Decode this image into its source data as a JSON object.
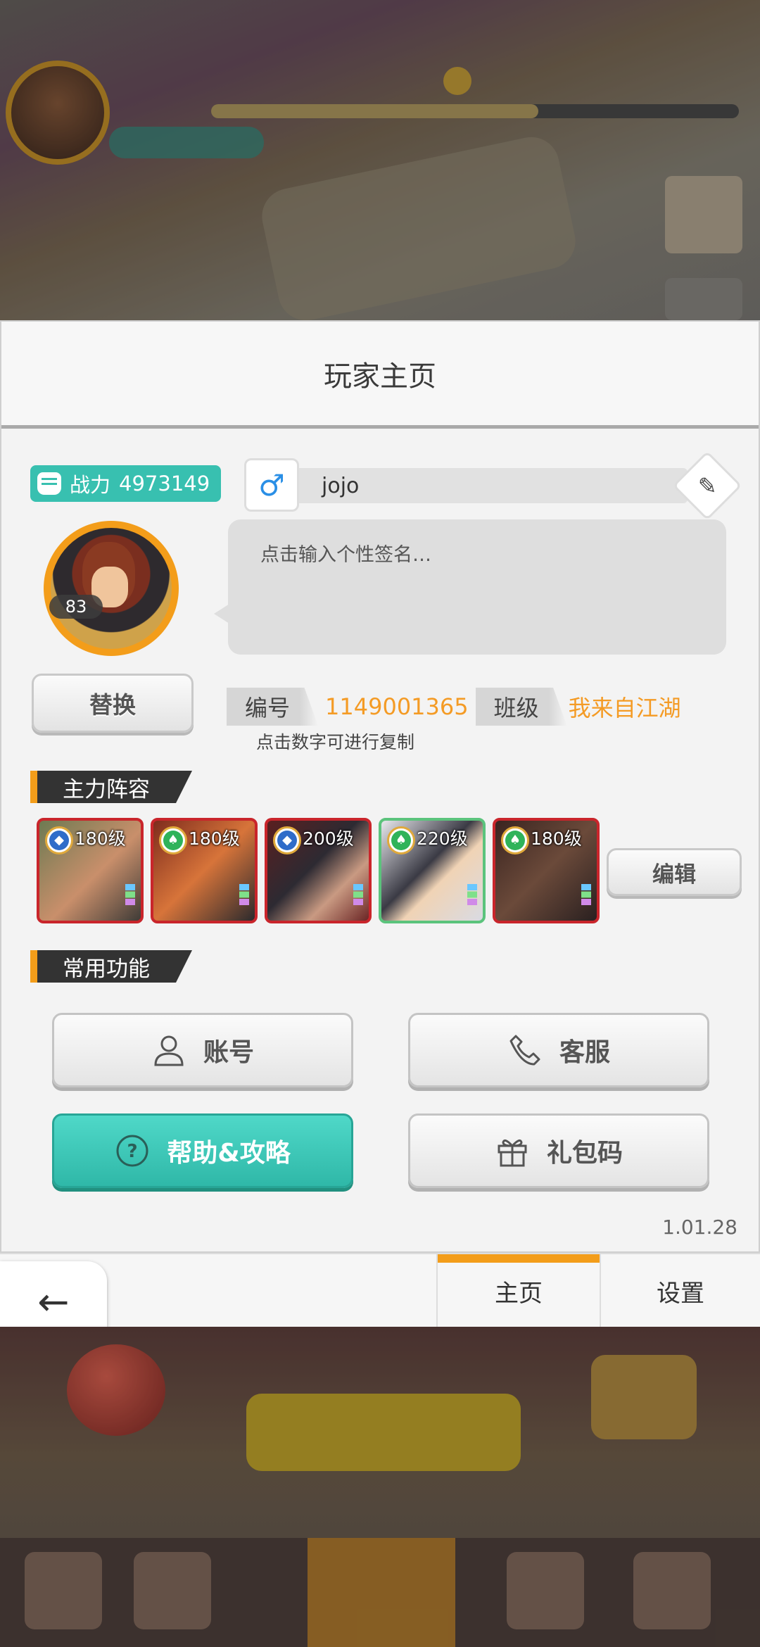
{
  "title": "玩家主页",
  "profile": {
    "power_label": "战力",
    "power_value": "4973149",
    "gender_symbol": "♂",
    "name": "jojo",
    "level": "83",
    "signature_placeholder": "点击输入个性签名…",
    "swap_button": "替换",
    "id_label": "编号",
    "id_value": "1149001365",
    "guild_label": "班级",
    "guild_value": "我来自江湖",
    "copy_hint": "点击数字可进行复制"
  },
  "lineup": {
    "title": "主力阵容",
    "edit_button": "编辑",
    "heroes": [
      {
        "level": "180级",
        "rank": "blue"
      },
      {
        "level": "180级",
        "rank": "green"
      },
      {
        "level": "200级",
        "rank": "blue"
      },
      {
        "level": "220级",
        "rank": "green"
      },
      {
        "level": "180级",
        "rank": "green"
      }
    ]
  },
  "functions": {
    "title": "常用功能",
    "account": "账号",
    "service": "客服",
    "help": "帮助&攻略",
    "gift_code": "礼包码"
  },
  "version": "1.01.28",
  "tabs": {
    "home": "主页",
    "settings": "设置"
  },
  "back_label": "返回",
  "colors": {
    "accent_orange": "#f39d1a",
    "teal": "#38c0b0",
    "hero_border_red": "#c9252b",
    "hero_border_green": "#5bc37c"
  }
}
